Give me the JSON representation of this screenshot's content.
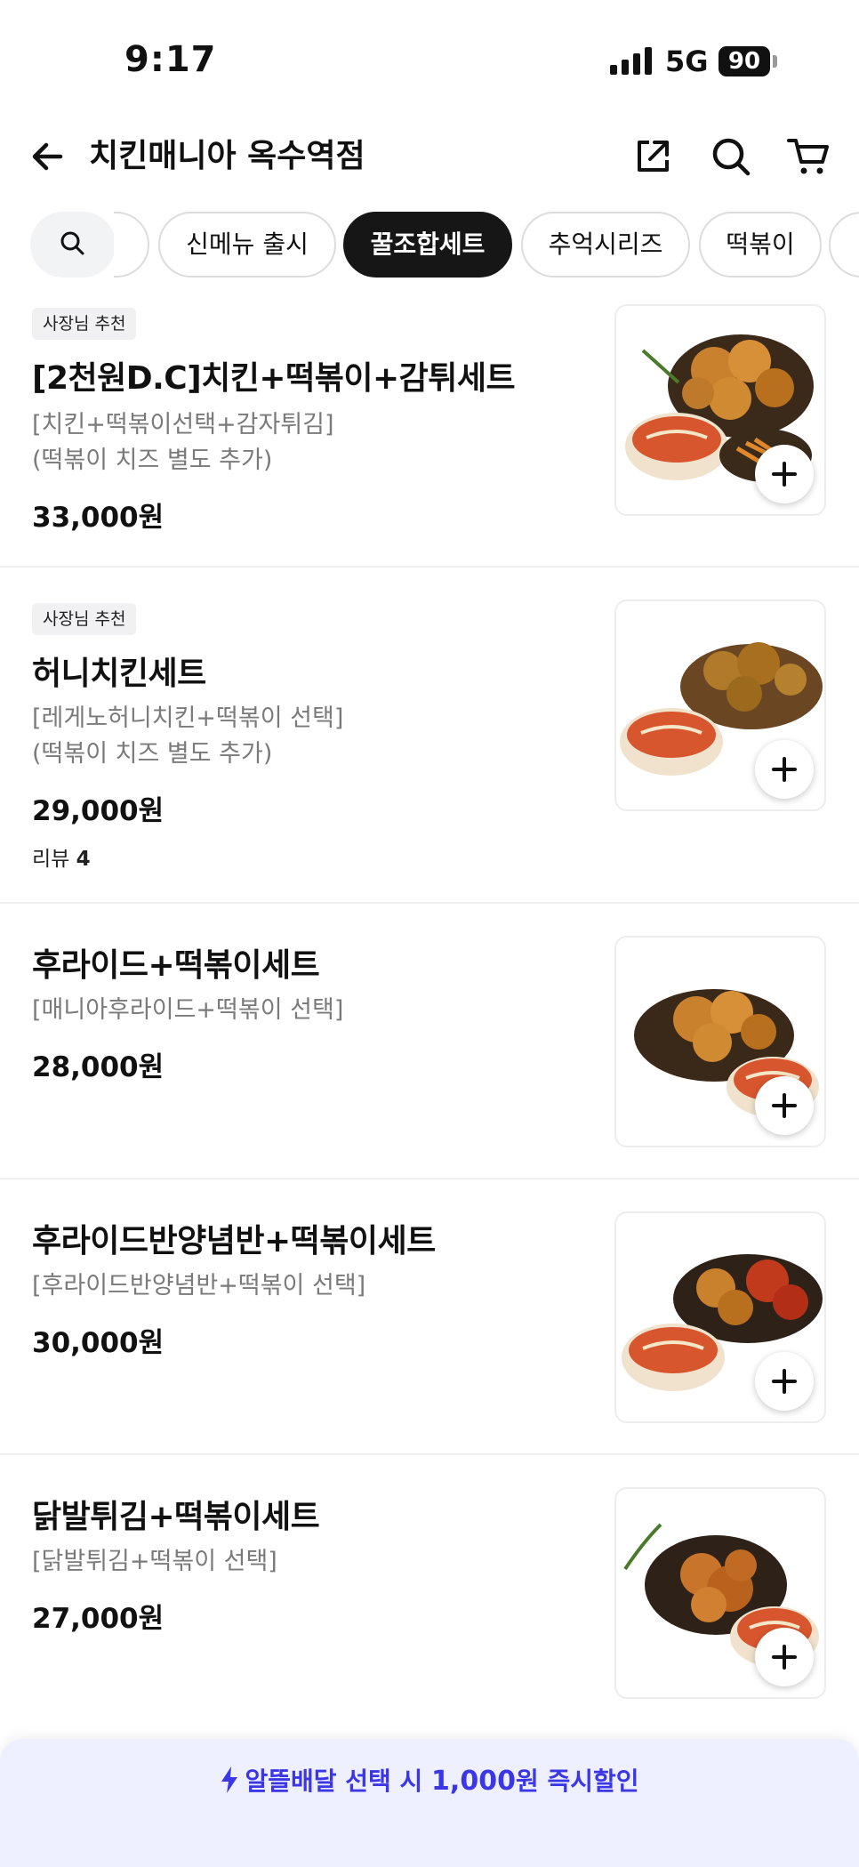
{
  "status_bar": {
    "time": "9:17",
    "network": "5G",
    "battery": "90"
  },
  "header": {
    "title": "치킨매니아 옥수역점"
  },
  "categories": [
    "신메뉴 출시",
    "꿀조합세트",
    "추억시리즈",
    "떡볶이"
  ],
  "active_category": "꿀조합세트",
  "menu_items": [
    {
      "badge": "사장님 추천",
      "name": "[2천원D.C]치킨+떡볶이+감튀세트",
      "desc1": "[치킨+떡볶이선택+감자튀김]",
      "desc2": "(떡볶이 치즈 별도 추가)",
      "price": "33,000원"
    },
    {
      "badge": "사장님 추천",
      "name": "허니치킨세트",
      "desc1": "[레게노허니치킨+떡볶이 선택]",
      "desc2": "(떡볶이 치즈 별도 추가)",
      "price": "29,000원",
      "review_label": "리뷰",
      "review_count": "4"
    },
    {
      "name": "후라이드+떡볶이세트",
      "desc1": "[매니아후라이드+떡볶이 선택]",
      "price": "28,000원"
    },
    {
      "name": "후라이드반양념반+떡볶이세트",
      "desc1": "[후라이드반양념반+떡볶이 선택]",
      "price": "30,000원"
    },
    {
      "name": "닭발튀김+떡볶이세트",
      "desc1": "[닭발튀김+떡볶이 선택]",
      "price": "27,000원"
    }
  ],
  "promo": {
    "part1": "알뜰배달 선택 시 ",
    "amount": "1,000",
    "part2": "원 즉시할인",
    "color": "#3b36e6"
  },
  "icons": [
    "back-arrow-icon",
    "share-icon",
    "search-icon",
    "cart-icon",
    "plus-icon",
    "lightning-icon"
  ]
}
